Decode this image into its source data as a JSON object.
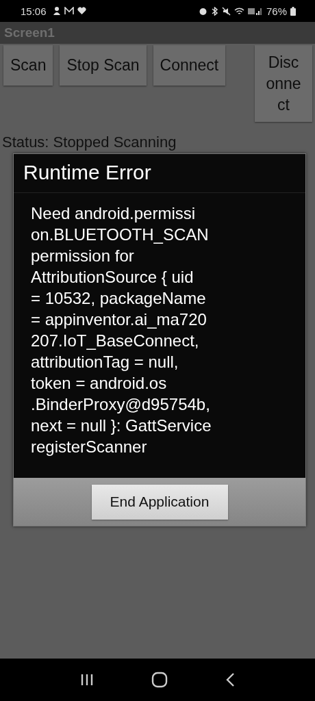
{
  "status_bar": {
    "time": "15:06",
    "battery": "76%"
  },
  "title_bar": {
    "title": "Screen1"
  },
  "buttons": [
    {
      "label": "Scan"
    },
    {
      "label": "Stop Scan"
    },
    {
      "label": "Connect"
    },
    {
      "label": "Disc\nonne\nct"
    }
  ],
  "status_label": "Status: Stopped Scanning",
  "dialog": {
    "title": "Runtime Error",
    "message_lines": [
      "Need android.permissi",
      "on.BLUETOOTH_SCAN",
      "permission for",
      "AttributionSource { uid",
      "= 10532, packageName",
      "= appinventor.ai_ma720",
      "207.IoT_BaseConnect,",
      "attributionTag = null,",
      "token = android.os",
      ".BinderProxy@d95754b,",
      "next = null }: GattService",
      "registerScanner"
    ],
    "button": "End Application"
  }
}
